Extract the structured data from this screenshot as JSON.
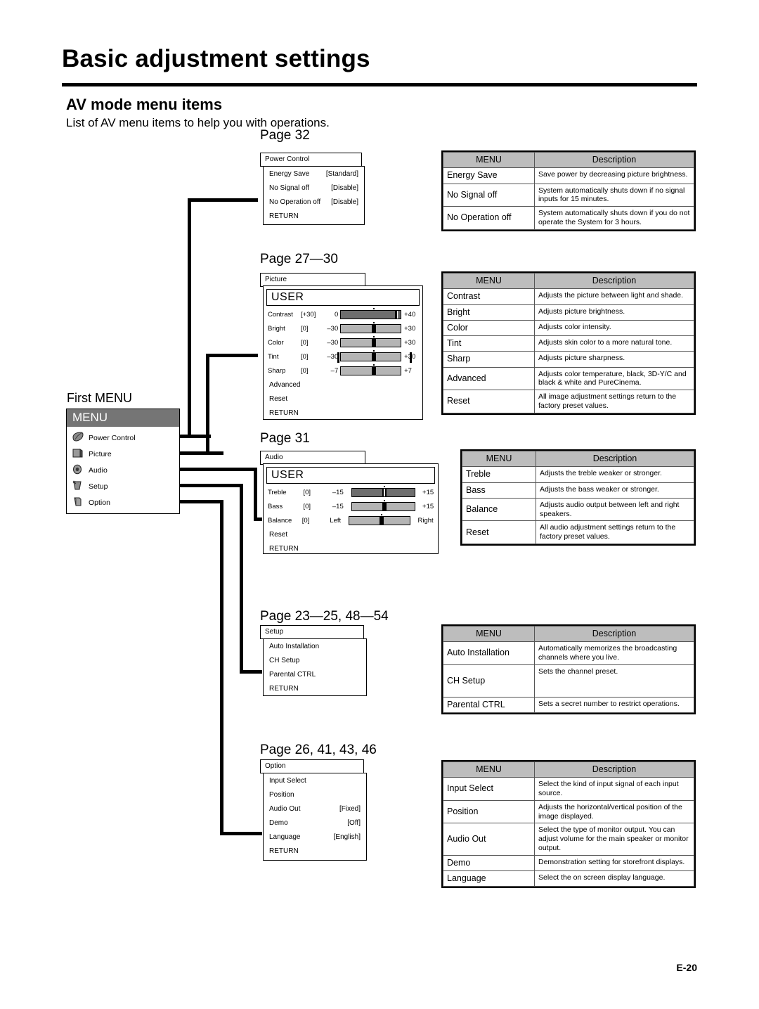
{
  "header": {
    "title": "Basic adjustment settings",
    "section_title": "AV mode menu items",
    "section_subtitle": "List of AV menu items to help you with operations.",
    "footer": "E-20"
  },
  "labels": {
    "first_menu": "First MENU",
    "page_power": "Page 32",
    "page_picture": "Page 27—30",
    "page_audio": "Page 31",
    "page_setup": "Page 23—25, 48—54",
    "page_option": "Page 26, 41, 43, 46"
  },
  "first_menu": {
    "header": "MENU",
    "items": [
      {
        "label": "Power Control",
        "icon": "leaf-icon"
      },
      {
        "label": "Picture",
        "icon": "picture-icon"
      },
      {
        "label": "Audio",
        "icon": "speaker-icon"
      },
      {
        "label": "Setup",
        "icon": "wrench-icon"
      },
      {
        "label": "Option",
        "icon": "document-icon"
      }
    ]
  },
  "osd": {
    "power": {
      "tab": "Power Control",
      "rows": [
        {
          "label": "Energy Save",
          "value": "[Standard]"
        },
        {
          "label": "No Signal off",
          "value": "[Disable]"
        },
        {
          "label": "No Operation off",
          "value": "[Disable]"
        },
        {
          "label": "RETURN",
          "value": ""
        }
      ]
    },
    "picture": {
      "tab": "Picture",
      "user": "USER",
      "sliders": [
        {
          "name": "Contrast",
          "bracket": "[+30]",
          "min": "0",
          "max": "+40",
          "fill": "dark",
          "pos": 82,
          "thumb": "hollow",
          "endcaps": false
        },
        {
          "name": "Bright",
          "bracket": "[0]",
          "min": "–30",
          "max": "+30",
          "fill": "light",
          "pos": 50,
          "thumb": "solid",
          "endcaps": false
        },
        {
          "name": "Color",
          "bracket": "[0]",
          "min": "–30",
          "max": "+30",
          "fill": "light",
          "pos": 50,
          "thumb": "solid",
          "endcaps": false
        },
        {
          "name": "Tint",
          "bracket": "[0]",
          "min": "–30",
          "max": "+30",
          "fill": "light",
          "pos": 50,
          "thumb": "solid",
          "endcaps": true
        },
        {
          "name": "Sharp",
          "bracket": "[0]",
          "min": "–7",
          "max": "+7",
          "fill": "light",
          "pos": 50,
          "thumb": "solid",
          "endcaps": false
        }
      ],
      "items": [
        "Advanced",
        "Reset",
        "RETURN"
      ]
    },
    "audio": {
      "tab": "Audio",
      "user": "USER",
      "sliders": [
        {
          "name": "Treble",
          "bracket": "[0]",
          "min": "–15",
          "max": "+15",
          "fill": "dark",
          "pos": 50,
          "thumb": "hollow",
          "endcaps": false
        },
        {
          "name": "Bass",
          "bracket": "[0]",
          "min": "–15",
          "max": "+15",
          "fill": "light",
          "pos": 50,
          "thumb": "solid",
          "endcaps": false
        },
        {
          "name": "Balance",
          "bracket": "[0]",
          "min": "Left",
          "max": "Right",
          "fill": "light",
          "pos": 50,
          "thumb": "solid",
          "endcaps": false
        }
      ],
      "items": [
        "Reset",
        "RETURN"
      ]
    },
    "setup": {
      "tab": "Setup",
      "rows": [
        {
          "label": "Auto Installation",
          "value": ""
        },
        {
          "label": "CH Setup",
          "value": ""
        },
        {
          "label": "Parental CTRL",
          "value": ""
        },
        {
          "label": "RETURN",
          "value": ""
        }
      ]
    },
    "option": {
      "tab": "Option",
      "rows": [
        {
          "label": "Input Select",
          "value": ""
        },
        {
          "label": "Position",
          "value": ""
        },
        {
          "label": "Audio Out",
          "value": "[Fixed]"
        },
        {
          "label": "Demo",
          "value": "[Off]"
        },
        {
          "label": "Language",
          "value": "[English]"
        },
        {
          "label": "RETURN",
          "value": ""
        }
      ]
    }
  },
  "tables": {
    "head_menu": "MENU",
    "head_desc": "Description",
    "power": [
      {
        "menu": "Energy Save",
        "desc": "Save power by decreasing picture brightness."
      },
      {
        "menu": "No Signal off",
        "desc": "System automatically shuts down if no signal inputs for 15 minutes."
      },
      {
        "menu": "No Operation off",
        "desc": "System automatically shuts down if you do not operate the System for 3 hours."
      }
    ],
    "picture": [
      {
        "menu": "Contrast",
        "desc": "Adjusts the picture between light and shade."
      },
      {
        "menu": "Bright",
        "desc": "Adjusts picture brightness."
      },
      {
        "menu": "Color",
        "desc": "Adjusts color intensity."
      },
      {
        "menu": "Tint",
        "desc": "Adjusts skin color to a more natural tone."
      },
      {
        "menu": "Sharp",
        "desc": "Adjusts picture sharpness."
      },
      {
        "menu": "Advanced",
        "desc": "Adjusts color temperature, black, 3D-Y/C and black & white and PureCinema."
      },
      {
        "menu": "Reset",
        "desc": "All image adjustment settings return to the factory preset values."
      }
    ],
    "audio": [
      {
        "menu": "Treble",
        "desc": "Adjusts the treble weaker or stronger."
      },
      {
        "menu": "Bass",
        "desc": "Adjusts the bass weaker or stronger."
      },
      {
        "menu": "Balance",
        "desc": "Adjusts audio output between left and right speakers."
      },
      {
        "menu": "Reset",
        "desc": "All audio adjustment settings return to the factory preset values."
      }
    ],
    "setup": [
      {
        "menu": "Auto Installation",
        "desc": "Automatically memorizes the broadcasting channels where you live."
      },
      {
        "menu": "CH Setup",
        "desc": "Sets the channel preset."
      },
      {
        "menu": "Parental CTRL",
        "desc": "Sets a secret number to restrict operations."
      }
    ],
    "option": [
      {
        "menu": "Input Select",
        "desc": "Select the kind of input signal of each input source."
      },
      {
        "menu": "Position",
        "desc": "Adjusts the horizontal/vertical position of the image displayed."
      },
      {
        "menu": "Audio Out",
        "desc": "Select the type of monitor output. You can adjust volume for the main speaker or monitor output."
      },
      {
        "menu": "Demo",
        "desc": "Demonstration setting for storefront displays."
      },
      {
        "menu": "Language",
        "desc": "Select the on screen display language."
      }
    ]
  }
}
